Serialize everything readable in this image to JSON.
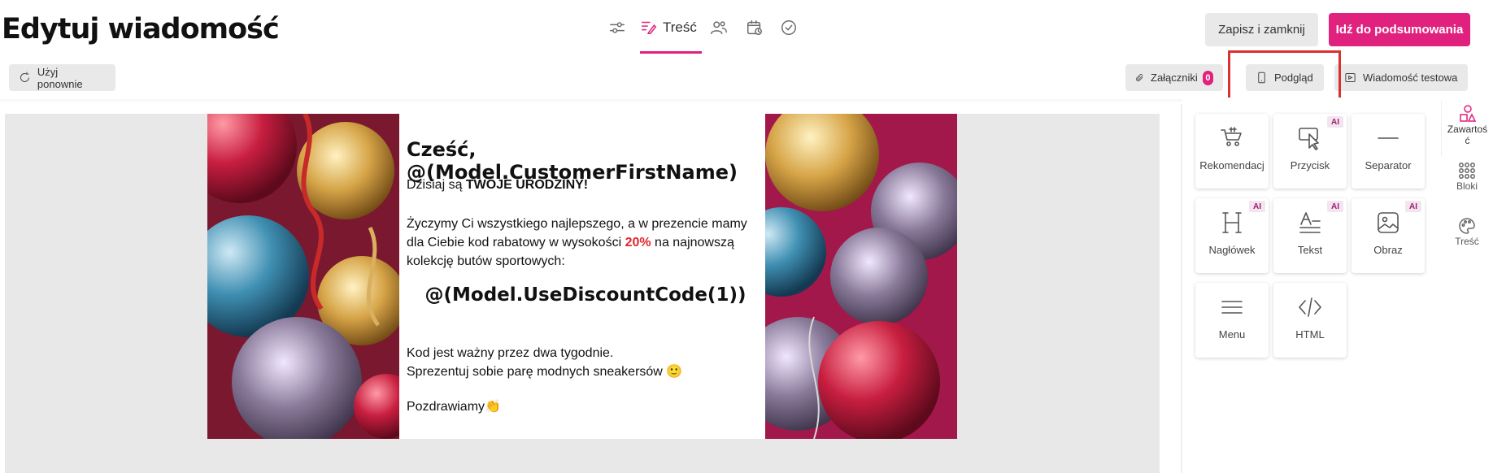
{
  "header": {
    "title": "Edytuj wiadomość",
    "active_tab_label": "Treść",
    "save_close_label": "Zapisz i zamknij",
    "summary_label": "Idź do podsumowania"
  },
  "toolbar": {
    "reuse_label": "Użyj ponownie",
    "attachments_label": "Załączniki",
    "attachments_count": "0",
    "preview_label": "Podgląd",
    "test_message_label": "Wiadomość testowa"
  },
  "email": {
    "greeting": "Cześć, @(Model.CustomerFirstName)",
    "line1_prefix": "Dzisiaj są ",
    "line1_bold": "TWOJE URODZINY!",
    "wish_line1": "Życzymy Ci wszystkiego najlepszego, a w prezencie mamy",
    "wish_line2_prefix": "dla Ciebie kod rabatowy w wysokości ",
    "discount": "20%",
    "wish_line2_suffix": " na najnowszą",
    "wish_line3": "kolekcję butów sportowych:",
    "code": "@(Model.UseDiscountCode(1))",
    "valid_line": "Kod jest ważny przez dwa tygodnie.",
    "gift_line": "Sprezentuj sobie parę modnych sneakersów 🙂",
    "closing": "Pozdrawiamy👏"
  },
  "blocks": {
    "ai_badge": "AI",
    "items": [
      {
        "label": "Rekomendacj",
        "icon": "cart-icon",
        "ai": false
      },
      {
        "label": "Przycisk",
        "icon": "cursor-icon",
        "ai": true
      },
      {
        "label": "Separator",
        "icon": "separator-icon",
        "ai": false
      },
      {
        "label": "Nagłówek",
        "icon": "heading-icon",
        "ai": true
      },
      {
        "label": "Tekst",
        "icon": "text-icon",
        "ai": true
      },
      {
        "label": "Obraz",
        "icon": "image-icon",
        "ai": true
      },
      {
        "label": "Menu",
        "icon": "menu-icon",
        "ai": false
      },
      {
        "label": "HTML",
        "icon": "code-icon",
        "ai": false
      }
    ]
  },
  "sidenav": {
    "content_label_1": "Zawartoś",
    "content_label_2": "ć",
    "blocks_label": "Bloki",
    "style_label": "Treść"
  },
  "colors": {
    "accent": "#e0217e",
    "discount_red": "#e0262e",
    "highlight_border": "#d9312f"
  }
}
